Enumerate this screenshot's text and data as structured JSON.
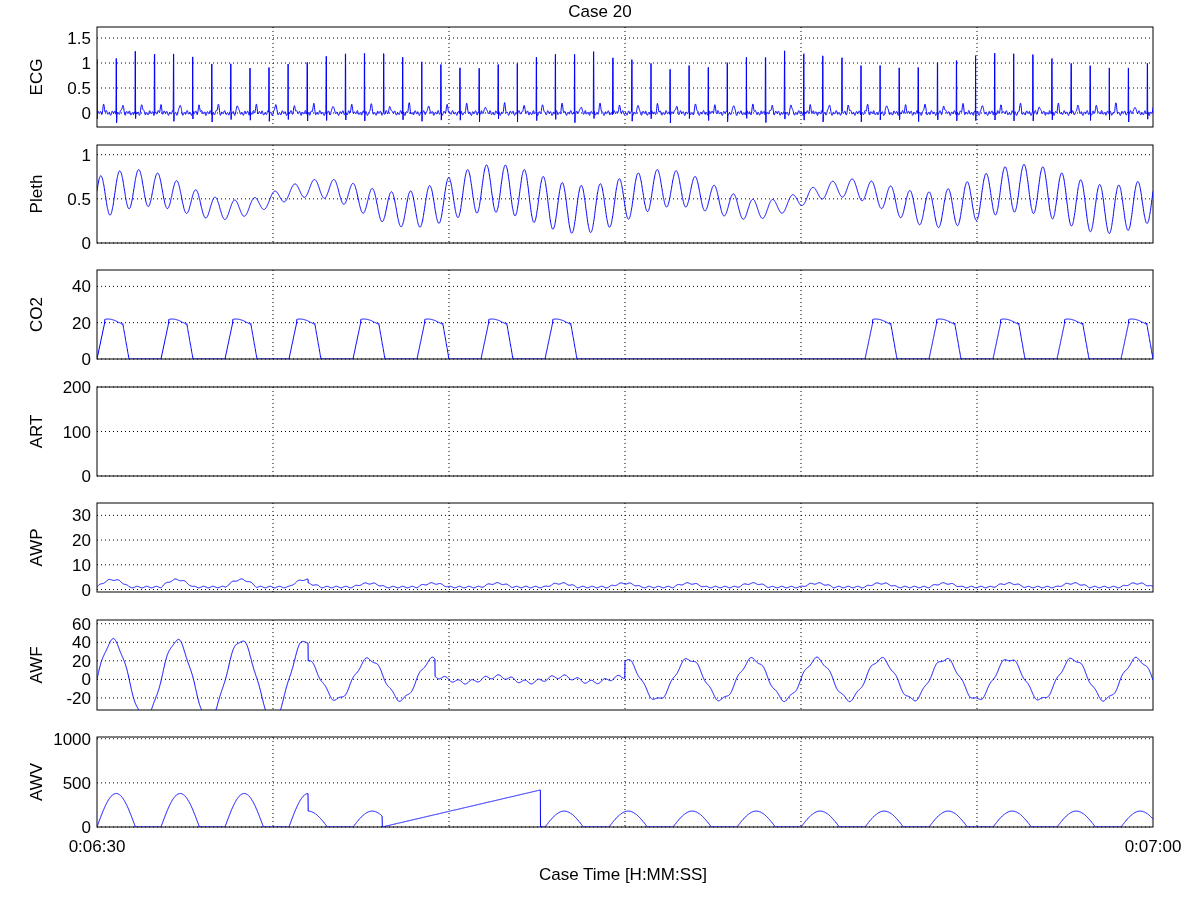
{
  "title": "Case 20",
  "panels": [
    {
      "ylabel": "ECG",
      "kind": "ecg",
      "yticks": [
        "1.5",
        "1",
        "0.5",
        "0"
      ]
    },
    {
      "ylabel": "Pleth",
      "kind": "pleth",
      "yticks": [
        "1",
        "0.5",
        "0"
      ]
    },
    {
      "ylabel": "CO2",
      "kind": "co2",
      "yticks": [
        "40",
        "20",
        "0"
      ]
    },
    {
      "ylabel": "ART",
      "kind": "empty",
      "yticks": [
        "200",
        "100",
        "0"
      ]
    },
    {
      "ylabel": "AWP",
      "kind": "awp",
      "yticks": [
        "30",
        "20",
        "10",
        "0"
      ]
    },
    {
      "ylabel": "AWF",
      "kind": "awf",
      "yticks": [
        "60",
        "40",
        "20",
        "0",
        "-20"
      ]
    },
    {
      "ylabel": "AWV",
      "kind": "awv",
      "yticks": [
        "1000",
        "500",
        "0"
      ]
    }
  ],
  "xticks": [
    "0:06:30",
    "0:07:00"
  ],
  "xlabel": "Case Time [H:MM:SS]"
}
